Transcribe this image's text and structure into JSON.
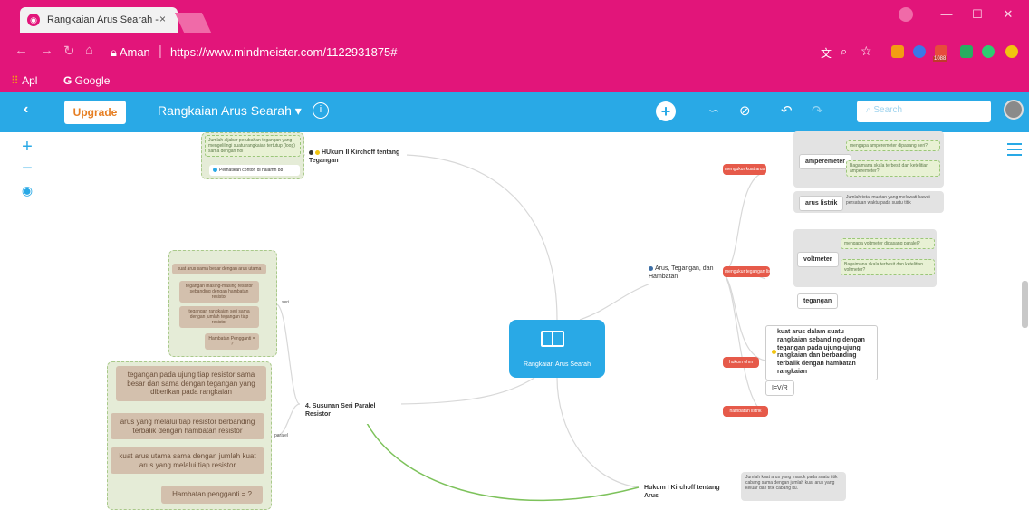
{
  "browser": {
    "tab_title": "Rangkaian Arus Searah - ",
    "tab_close": "×",
    "url_secure_label": "Aman",
    "url": "https://www.mindmeister.com/1122931875#",
    "bookmarks": {
      "apps": "Apl",
      "google": "Google"
    },
    "badge_count": "1088"
  },
  "toolbar": {
    "upgrade_label": "Upgrade",
    "map_title": "Rangkaian Arus Searah",
    "info_label": "i",
    "search_placeholder": "Search"
  },
  "mindmap": {
    "root": "Rangkaian Arus Searah",
    "kirchhoff2": {
      "title": "HUkum II Kirchoff tentang Tegangan",
      "note1": "Jumlah aljabar perubahan tegangan yang mengelilingi suatu rangkaian tertutup (loop) sama dengan nol",
      "note2": "Perhatikan contoh di halamn 88"
    },
    "arus_tegangan": {
      "title": "Arus, Tegangan, dan Hambatan",
      "mengukur_arus": "mengukur kuat arus listrik",
      "amperemeter": "amperemeter",
      "amp_q1": "mengapa amperemeter dipasang seri?",
      "amp_q2": "Bagaimana skala terbesit dan ketelitian amperemeter?",
      "arus_listrik": "arus listrik",
      "arus_def": "Jumlah total muatan yang melewati kawat persatuan waktu pada suatu titik",
      "mengukur_tegangan": "mengukur tegangan listrik",
      "voltmeter": "voltmeter",
      "volt_q1": "mengapa voltmeter dipasang paralel?",
      "volt_q2": "Bagaimana skala terbesit dan ketelitian voltmeter?",
      "tegangan": "tegangan",
      "hukum_ohm": "hukum ohm",
      "ohm_text": "kuat arus dalam suatu rangkaian sebanding dengan tegangan pada ujung-ujung rangkaian dan berbanding terbalik dengan hambatan rangkaian",
      "ohm_formula": "I=V/R",
      "hambatan": "hambatan listrik"
    },
    "susunan": {
      "title": "4. Susunan Seri Paralel Resistor",
      "seri_label": "seri",
      "seri": [
        "kuat arus sama besar dengan arus utama",
        "tegangan masing-masing resistor sebanding dengan hambatan resistor",
        "tegangan rangkaian seri sama dengan jumlah tegangan tiap resistor",
        "Hambatan Pengganti = ?"
      ],
      "paralel_label": "paralel",
      "paralel": [
        "tegangan pada ujung tiap resistor sama besar dan sama dengan tegangan yang diberikan pada rangkaian",
        "arus yang melalui tiap resistor berbanding terbalik dengan hambatan resistor",
        "kuat arus utama sama dengan jumlah kuat arus yang melalui tiap resistor",
        "Hambatan pengganti = ?"
      ]
    },
    "kirchhoff1": {
      "title": "Hukum I Kirchoff tentang Arus",
      "note": "Jumlah kuat arus yang masuk pada suatu titik cabang sama dengan jumlah kuat arus yang keluar dari titik cabang itu."
    }
  },
  "colors": {
    "browser": "#e2157a",
    "toolbar": "#29a9e6",
    "red_pill": "#e65a4a",
    "note_green": "#e5ecd7",
    "note_tan": "#d3c0ad"
  }
}
